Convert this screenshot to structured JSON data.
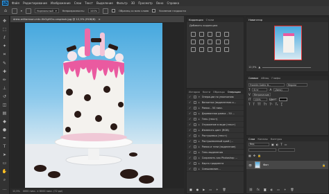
{
  "app": {
    "logo": "Ps"
  },
  "menu": [
    "Файл",
    "Редактирование",
    "Изображение",
    "Слои",
    "Текст",
    "Выделение",
    "Фильтр",
    "3D",
    "Просмотр",
    "Окно",
    "Справка"
  ],
  "options": {
    "mode_value": "Нормальный",
    "opacity_label": "Непрозрачность:",
    "opacity_value": "100%",
    "sample_label": "Образец со всех слоев",
    "protect_label": "Усиление гладкости"
  },
  "document": {
    "tab_title": "drew-williamson-mtc-0kOgHOx-unsplash.jpg @ 12,5% (RGB/8)",
    "close_glyph": "×",
    "status": "12,5%",
    "status_dims": "4000 пикс. × 6000 пикс. (72 ppi)"
  },
  "panels": {
    "correction": {
      "tabs": [
        "Коррекция",
        "Стили"
      ],
      "subtitle": "Добавить коррекцию"
    },
    "navigator": {
      "tabs": [
        "Навигатор"
      ],
      "zoom": "12,5%"
    },
    "properties": {
      "tabs": [
        "Символ",
        "Абзац",
        "Глифы"
      ],
      "font_family": "Franklin Gothic B…",
      "font_style": "Regular",
      "size": "6 пт",
      "leading": "(Авто)",
      "tracking": "Метрические",
      "scale": "100%",
      "color_label": "Цвет:"
    },
    "actions": {
      "tabs": [
        "История",
        "Кисти",
        "Образцы",
        "Операции"
      ],
      "rows": [
        {
          "name": "Операции по умолчанию",
          "selected": false
        },
        {
          "name": "Виньетка (выделенная о...",
          "selected": false
        },
        {
          "name": "Рамка – 50 пикс.",
          "selected": false
        },
        {
          "name": "Деревянная рамка – 50 ...",
          "selected": false
        },
        {
          "name": "Тень (текст)",
          "selected": false
        },
        {
          "name": "Отражение в воде (текст)",
          "selected": false
        },
        {
          "name": "Изменить цвет (RGB)",
          "selected": false
        },
        {
          "name": "Растушевка (текст)",
          "selected": false
        },
        {
          "name": "Растушеванный край (...",
          "selected": false
        },
        {
          "name": "Рамка и тени (выделение)",
          "selected": false
        },
        {
          "name": "Тень выделения",
          "selected": false
        },
        {
          "name": "Сохранить как Photoshop ...",
          "selected": false
        },
        {
          "name": "Карта градиента",
          "selected": false
        },
        {
          "name": "Смешивание...",
          "selected": false
        }
      ]
    },
    "layers": {
      "tabs": [
        "Слои",
        "Каналы",
        "Контуры"
      ],
      "search_placeholder": "Вид",
      "layer_name": "Фон"
    }
  }
}
